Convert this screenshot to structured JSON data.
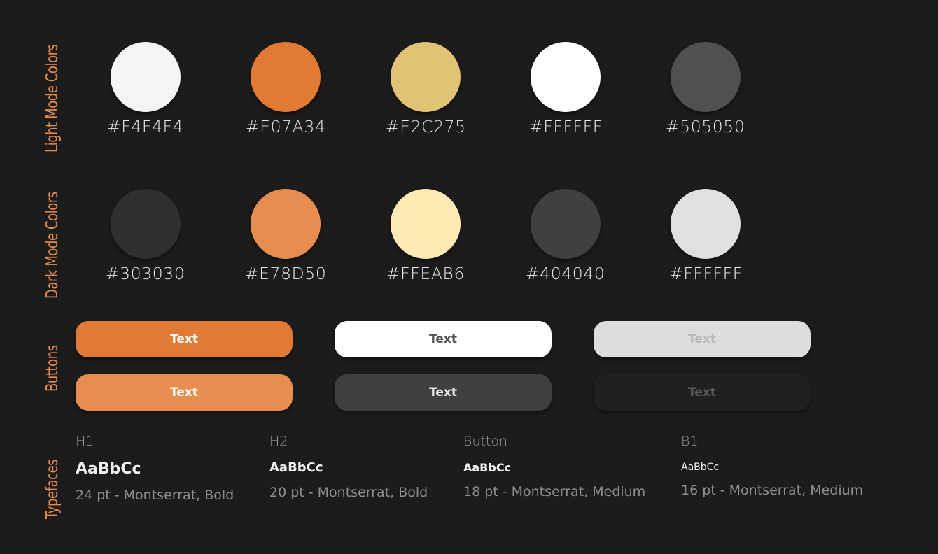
{
  "sections": {
    "light": "Light Mode Colors",
    "dark": "Dark Mode Colors",
    "buttons": "Buttons",
    "typefaces": "Typefaces"
  },
  "light_colors": [
    {
      "hex": "#F4F4F4",
      "swatch": "#F4F4F4"
    },
    {
      "hex": "#E07A34",
      "swatch": "#E07A34"
    },
    {
      "hex": "#E2C275",
      "swatch": "#E2C275"
    },
    {
      "hex": "#FFFFFF",
      "swatch": "#FFFFFF"
    },
    {
      "hex": "#505050",
      "swatch": "#505050"
    }
  ],
  "dark_colors": [
    {
      "hex": "#303030",
      "swatch": "#303030"
    },
    {
      "hex": "#E78D50",
      "swatch": "#E78D50"
    },
    {
      "hex": "#FFEAB6",
      "swatch": "#FFEAB6"
    },
    {
      "hex": "#404040",
      "swatch": "#404040"
    },
    {
      "hex": "#FFFFFF",
      "swatch": "#E0E0E0"
    }
  ],
  "buttons": [
    {
      "label": "Text",
      "bg": "#E07A34",
      "fg": "#FFFFFF"
    },
    {
      "label": "Text",
      "bg": "#FFFFFF",
      "fg": "#505050"
    },
    {
      "label": "Text",
      "bg": "#DDDDDD",
      "fg": "#B8B8B8"
    },
    {
      "label": "Text",
      "bg": "#E78D50",
      "fg": "#FFFFFF"
    },
    {
      "label": "Text",
      "bg": "#404040",
      "fg": "#E8E8E8"
    },
    {
      "label": "Text",
      "bg": "#202020",
      "fg": "#5C5C5C"
    }
  ],
  "typefaces": [
    {
      "name": "H1",
      "sample": "AaBbCc",
      "desc": "24 pt - Montserrat, Bold"
    },
    {
      "name": "H2",
      "sample": "AaBbCc",
      "desc": "20 pt - Montserrat, Bold"
    },
    {
      "name": "Button",
      "sample": "AaBbCc",
      "desc": "18 pt - Montserrat, Medium"
    },
    {
      "name": "B1",
      "sample": "AaBbCc",
      "desc": "16 pt - Montserrat, Medium"
    }
  ]
}
